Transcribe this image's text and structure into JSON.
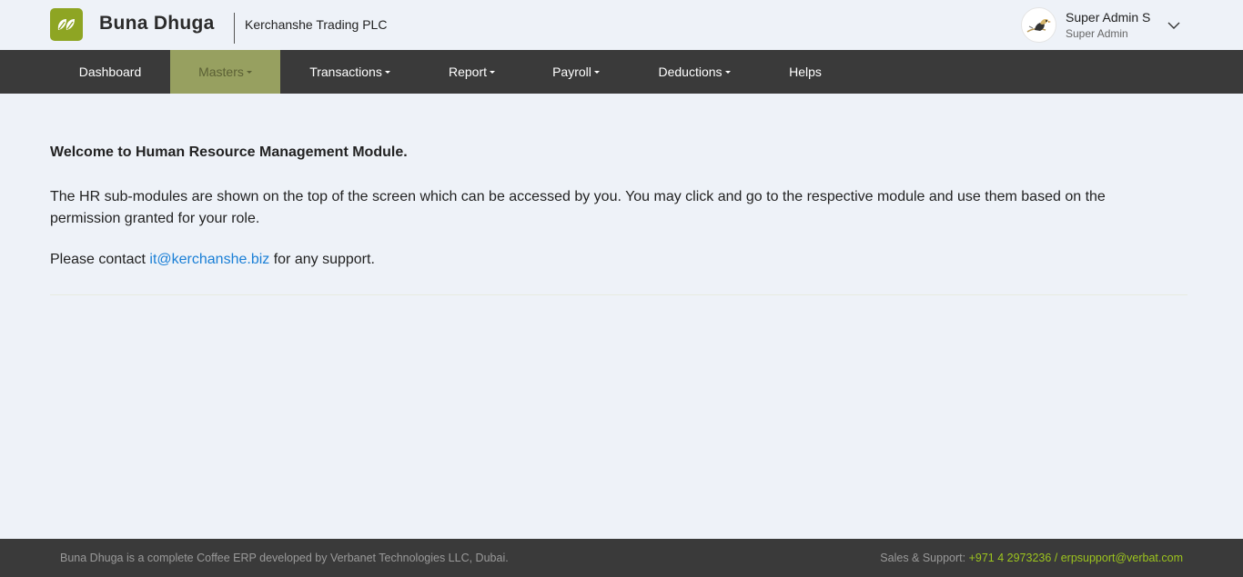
{
  "header": {
    "brand_name": "Buna Dhuga",
    "company_name": "Kerchanshe Trading PLC",
    "brand_color": "#8ea523",
    "logo_icon": "coffee-leaves-icon",
    "user": {
      "name": "Super Admin S",
      "role": "Super Admin",
      "avatar_icon": "bird-avatar",
      "dropdown_icon": "chevron-down-icon"
    }
  },
  "nav": {
    "items": [
      {
        "label": "Dashboard",
        "dropdown": false,
        "active": false
      },
      {
        "label": "Masters",
        "dropdown": true,
        "active": true
      },
      {
        "label": "Transactions",
        "dropdown": true,
        "active": false
      },
      {
        "label": "Report",
        "dropdown": true,
        "active": false
      },
      {
        "label": "Payroll",
        "dropdown": true,
        "active": false
      },
      {
        "label": "Deductions",
        "dropdown": true,
        "active": false
      },
      {
        "label": "Helps",
        "dropdown": false,
        "active": false
      }
    ],
    "active_color": "#97a060",
    "background_color": "#3a3a3a"
  },
  "main": {
    "welcome": "Welcome to Human Resource Management Module.",
    "description": "The HR sub-modules are shown on the top of the screen which can be accessed by you. You may click and go to the respective module and use them based on the permission granted for your role.",
    "contact_prefix": "Please contact ",
    "contact_email": "it@kerchanshe.biz",
    "contact_suffix": " for any support.",
    "link_color": "#1a7fd6"
  },
  "footer": {
    "left_text": "Buna Dhuga is a complete Coffee ERP developed by Verbanet Technologies LLC, Dubai.",
    "support_label": "Sales & Support: ",
    "support_contact": "+971 4 2973236 / erpsupport@verbat.com",
    "highlight_color": "#9cc41e"
  }
}
